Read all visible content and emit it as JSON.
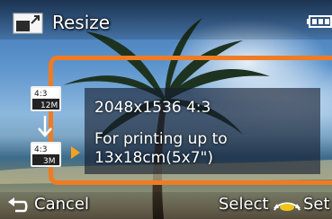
{
  "header": {
    "title": "Resize",
    "icons": [
      "resize-icon",
      "battery-icon"
    ]
  },
  "resize_panel": {
    "from_badge": {
      "ratio": "4:3",
      "size": "12M"
    },
    "to_badge": {
      "ratio": "4:3",
      "size": "3M"
    },
    "resolution_text": "2048x1536 4:3",
    "description_line1": "For printing up to",
    "description_line2": "13x18cm(5x7\")"
  },
  "footer": {
    "cancel_label": "Cancel",
    "select_label": "Select",
    "set_label": "Set"
  },
  "colors": {
    "frame_accent": "#f07b22",
    "badge_size_bg": "#e0e0e0"
  }
}
